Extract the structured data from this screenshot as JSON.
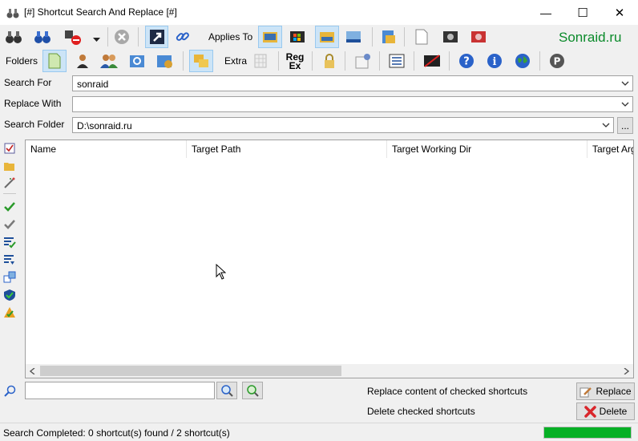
{
  "window": {
    "title": "[#] Shortcut Search And Replace [#]",
    "minimize_glyph": "—",
    "maximize_glyph": "☐",
    "close_glyph": "✕"
  },
  "toolbar1": {
    "applies_to_label": "Applies To",
    "brand": "Sonraid.ru"
  },
  "toolbar2": {
    "folders_label": "Folders",
    "extra_label": "Extra",
    "regex_label_top": "Reg",
    "regex_label_bottom": "Ex"
  },
  "form": {
    "search_for_label": "Search For",
    "search_for_value": "sonraid",
    "replace_with_label": "Replace With",
    "replace_with_value": "",
    "search_folder_label": "Search Folder",
    "search_folder_value": "D:\\sonraid.ru",
    "browse_label": "..."
  },
  "list": {
    "columns": [
      "Name",
      "Target Path",
      "Target Working Dir",
      "Target Arg"
    ],
    "rows": []
  },
  "actions": {
    "replace_text": "Replace content of checked shortcuts",
    "delete_text": "Delete checked shortcuts",
    "replace_button": "Replace",
    "delete_button": "Delete"
  },
  "status": {
    "text": "Search Completed: 0 shortcut(s) found / 2 shortcut(s)",
    "progress_fraction": 1.0
  },
  "colors": {
    "brand": "#0a8a2a",
    "progress": "#06b025",
    "pressed": "#cce4f7",
    "delete_red": "#d9262b"
  }
}
